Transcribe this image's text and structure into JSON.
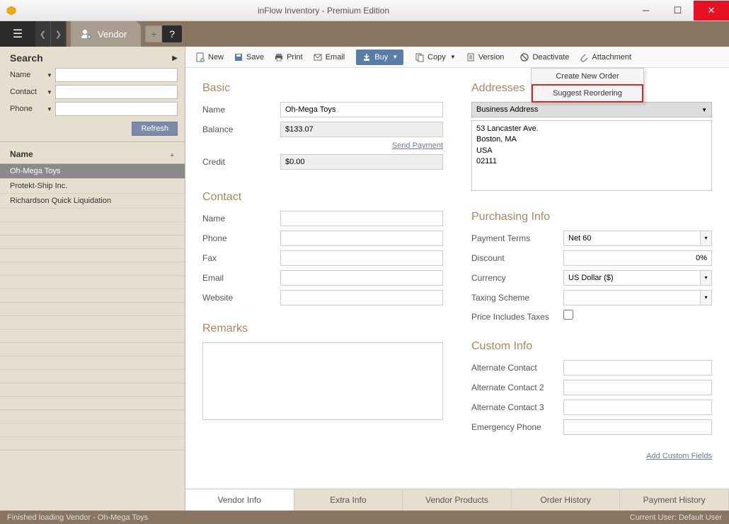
{
  "window": {
    "title": "inFlow Inventory - Premium Edition"
  },
  "topnav": {
    "tab_label": "Vendor"
  },
  "search": {
    "title": "Search",
    "name_label": "Name",
    "contact_label": "Contact",
    "phone_label": "Phone",
    "refresh_label": "Refresh",
    "column_header": "Name"
  },
  "vendor_list": [
    "Oh-Mega Toys",
    "Protekt-Ship Inc.",
    "Richardson Quick Liquidation"
  ],
  "toolbar": {
    "new": "New",
    "save": "Save",
    "print": "Print",
    "email": "Email",
    "buy": "Buy",
    "copy": "Copy",
    "version": "Version",
    "deactivate": "Deactivate",
    "attachment": "Attachment"
  },
  "buy_menu": {
    "create": "Create New Order",
    "suggest": "Suggest Reordering"
  },
  "basic": {
    "title": "Basic",
    "name_label": "Name",
    "name_value": "Oh-Mega Toys",
    "balance_label": "Balance",
    "balance_value": "$133.07",
    "send_payment": "Send Payment",
    "credit_label": "Credit",
    "credit_value": "$0.00"
  },
  "contact": {
    "title": "Contact",
    "name_label": "Name",
    "phone_label": "Phone",
    "fax_label": "Fax",
    "email_label": "Email",
    "website_label": "Website"
  },
  "remarks": {
    "title": "Remarks"
  },
  "addresses": {
    "title": "Addresses",
    "selector": "Business Address",
    "text": "53 Lancaster Ave.\nBoston, MA\nUSA\n02111"
  },
  "purchasing": {
    "title": "Purchasing Info",
    "payment_terms_label": "Payment Terms",
    "payment_terms_value": "Net 60",
    "discount_label": "Discount",
    "discount_value": "0%",
    "currency_label": "Currency",
    "currency_value": "US Dollar ($)",
    "taxing_label": "Taxing Scheme",
    "price_includes_label": "Price Includes Taxes"
  },
  "custom": {
    "title": "Custom Info",
    "alt1_label": "Alternate Contact",
    "alt2_label": "Alternate Contact 2",
    "alt3_label": "Alternate Contact 3",
    "emergency_label": "Emergency Phone",
    "add_link": "Add Custom Fields"
  },
  "bottom_tabs": {
    "vendor_info": "Vendor Info",
    "extra_info": "Extra Info",
    "vendor_products": "Vendor Products",
    "order_history": "Order History",
    "payment_history": "Payment History"
  },
  "status": {
    "left": "Finished loading Vendor - Oh-Mega Toys",
    "right": "Current User:  Default User"
  }
}
